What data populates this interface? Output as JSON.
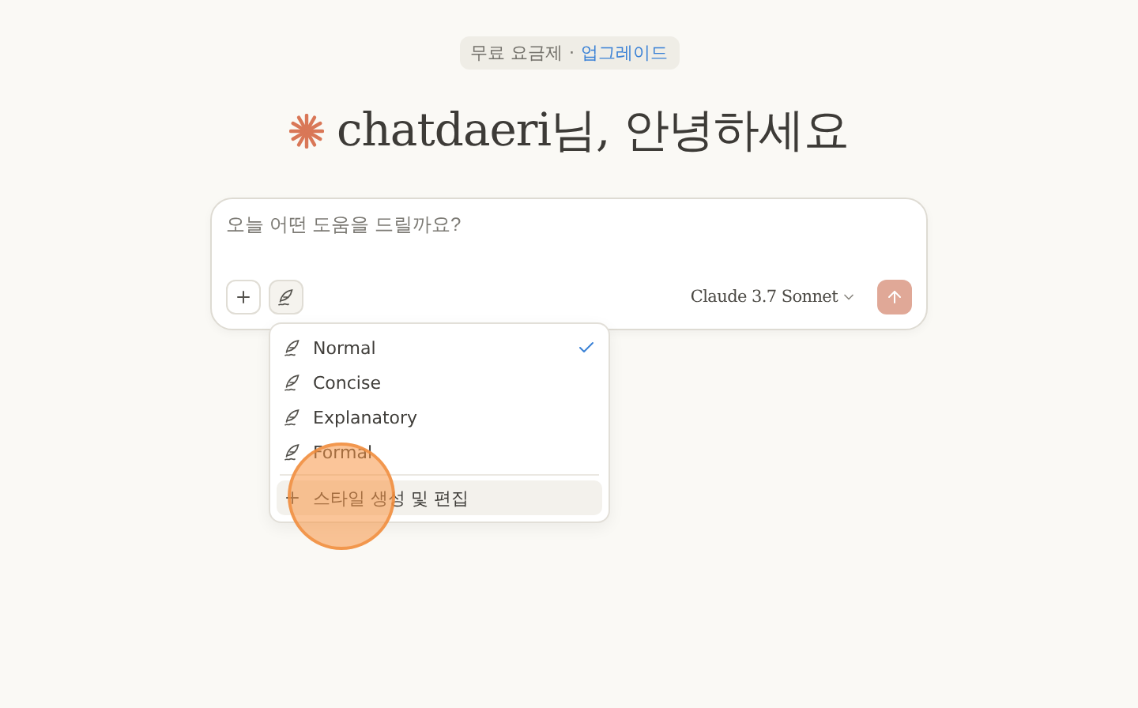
{
  "plan_badge": {
    "plan": "무료 요금제",
    "separator": "·",
    "link": "업그레이드"
  },
  "greeting": "chatdaeri님, 안녕하세요",
  "composer": {
    "placeholder": "오늘 어떤 도움을 드릴까요?",
    "model": "Claude 3.7 Sonnet",
    "style_menu_open": true
  },
  "style_menu": {
    "items": [
      {
        "label": "Normal",
        "selected": true
      },
      {
        "label": "Concise",
        "selected": false
      },
      {
        "label": "Explanatory",
        "selected": false
      },
      {
        "label": "Formal",
        "selected": false
      }
    ],
    "action": {
      "label": "스타일 생성 및 편집",
      "highlighted": true
    }
  },
  "click_indicator": true
}
